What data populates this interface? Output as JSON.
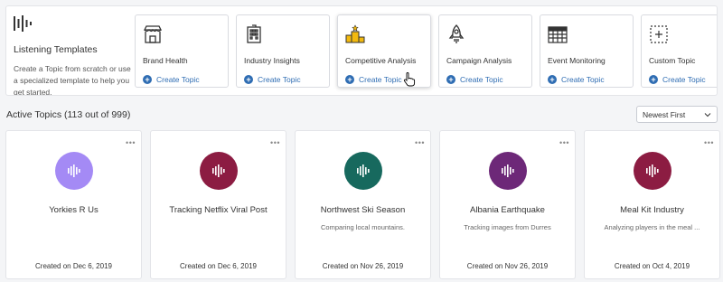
{
  "intro": {
    "logo_icon": "sound-wave-logo-icon",
    "title": "Listening Templates",
    "description": "Create a Topic from scratch or use a specialized template to help you get started."
  },
  "templates": [
    {
      "name": "Brand Health",
      "action": "Create Topic",
      "icon": "storefront-icon"
    },
    {
      "name": "Industry Insights",
      "action": "Create Topic",
      "icon": "building-icon"
    },
    {
      "name": "Competitive Analysis",
      "action": "Create Topic",
      "icon": "podium-icon",
      "accent": "#f2b90f"
    },
    {
      "name": "Campaign Analysis",
      "action": "Create Topic",
      "icon": "rocket-icon"
    },
    {
      "name": "Event Monitoring",
      "action": "Create Topic",
      "icon": "calendar-icon"
    },
    {
      "name": "Custom Topic",
      "action": "Create Topic",
      "icon": "dashed-plus-icon"
    }
  ],
  "active": {
    "title": "Active Topics (113 out of 999)",
    "sort_selected": "Newest First"
  },
  "topics": [
    {
      "name": "Yorkies R Us",
      "description": "",
      "created": "Created on Dec 6, 2019",
      "color": "#a48af5"
    },
    {
      "name": "Tracking Netflix Viral Post",
      "description": "",
      "created": "Created on Dec 6, 2019",
      "color": "#8c1c42"
    },
    {
      "name": "Northwest Ski Season",
      "description": "Comparing local mountains.",
      "created": "Created on Nov 26, 2019",
      "color": "#17695e"
    },
    {
      "name": "Albania Earthquake",
      "description": "Tracking images from Durres",
      "created": "Created on Nov 26, 2019",
      "color": "#6d2878"
    },
    {
      "name": "Meal Kit Industry",
      "description": "Analyzing players in the meal ...",
      "created": "Created on Oct 4, 2019",
      "color": "#8c1c42"
    }
  ],
  "colors": {
    "link": "#2f6db3",
    "background": "#f4f5f7"
  }
}
